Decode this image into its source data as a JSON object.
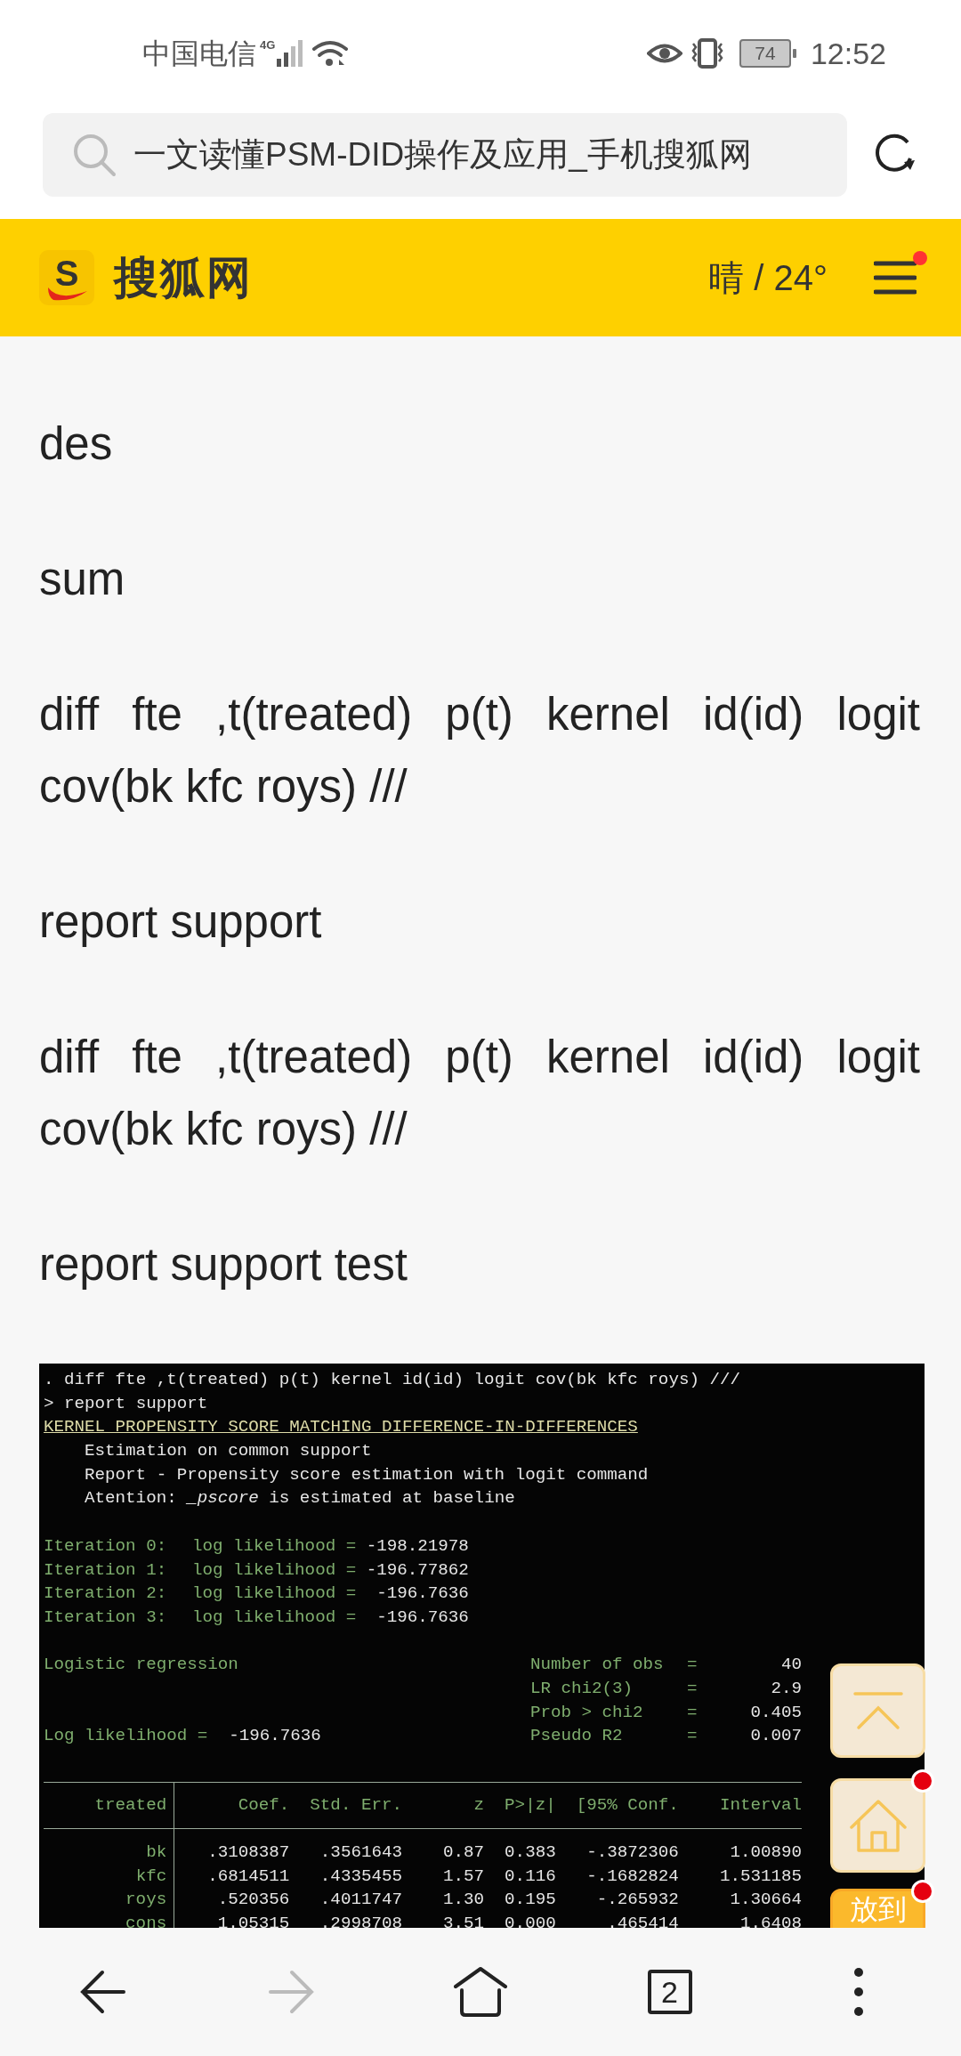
{
  "status_bar": {
    "carrier": "中国电信",
    "network": "4G",
    "battery": "74",
    "time": "12:52"
  },
  "address_bar": {
    "title": "一文读懂PSM-DID操作及应用_手机搜狐网"
  },
  "site_header": {
    "logo_letter": "S",
    "site_name": "搜狐网",
    "weather": "晴 / 24°",
    "menu_dot": true
  },
  "paragraphs": [
    "des",
    "sum",
    "diff fte ,t(treated) p(t) kernel id(id) logit cov(bk kfc roys) ///",
    "report support",
    "diff fte ,t(treated) p(t) kernel id(id) logit cov(bk kfc roys) ///",
    "report support test"
  ],
  "stata_output": {
    "lines": [
      {
        "kind": "command",
        "text": ". diff fte ,t(treated) p(t) kernel id(id) logit cov(bk kfc roys) ///"
      },
      {
        "kind": "command",
        "text": "> report support"
      },
      {
        "kind": "title",
        "text": "KERNEL PROPENSITY SCORE MATCHING DIFFERENCE-IN-DIFFERENCES"
      },
      {
        "kind": "note",
        "text": "Estimation on common support"
      },
      {
        "kind": "note",
        "text": "Report - Propensity score estimation with logit command"
      },
      {
        "kind": "note",
        "text": "Atention: *_pscore* is estimated at baseline"
      }
    ],
    "iterations": [
      {
        "label": "Iteration 0:",
        "text": "log likelihood =",
        "value": "-198.21978"
      },
      {
        "label": "Iteration 1:",
        "text": "log likelihood =",
        "value": "-196.77862"
      },
      {
        "label": "Iteration 2:",
        "text": "log likelihood =",
        "value": "-196.7636"
      },
      {
        "label": "Iteration 3:",
        "text": "log likelihood =",
        "value": "-196.7636"
      }
    ],
    "model": "Logistic regression",
    "log_likelihood": {
      "label": "Log likelihood =",
      "value": "-196.7636"
    },
    "stats": [
      {
        "label": "Number of obs",
        "eq": "=",
        "value": "40"
      },
      {
        "label": "LR chi2(3)",
        "eq": "=",
        "value": "2.9"
      },
      {
        "label": "Prob > chi2",
        "eq": "=",
        "value": "0.405"
      },
      {
        "label": "Pseudo R2",
        "eq": "=",
        "value": "0.007"
      }
    ],
    "table": {
      "columns": [
        "treated",
        "Coef.",
        "Std. Err.",
        "z",
        "P>|z|",
        "[95% Conf.",
        "Interval"
      ],
      "rows": [
        [
          "bk",
          ".3108387",
          ".3561643",
          "0.87",
          "0.383",
          "-.3872306",
          "1.00890"
        ],
        [
          "kfc",
          ".6814511",
          ".4335455",
          "1.57",
          "0.116",
          "-.1682824",
          "1.531185"
        ],
        [
          "roys",
          ".520356",
          ".4011747",
          "1.30",
          "0.195",
          "-.265932",
          "1.30664"
        ],
        [
          "cons",
          "1.05315",
          ".2998708",
          "3.51",
          "0.000",
          ".465414",
          "1.6408"
        ]
      ]
    }
  },
  "float_buttons": [
    {
      "kind": "top",
      "dot": false
    },
    {
      "kind": "home",
      "dot": true
    },
    {
      "kind": "label",
      "label": "放到",
      "dot": true
    }
  ],
  "bottom_nav": [
    {
      "kind": "back",
      "disabled": false
    },
    {
      "kind": "forward",
      "disabled": true
    },
    {
      "kind": "home",
      "disabled": false
    },
    {
      "kind": "tabs",
      "count": "2",
      "disabled": false
    },
    {
      "kind": "more",
      "disabled": false
    }
  ]
}
